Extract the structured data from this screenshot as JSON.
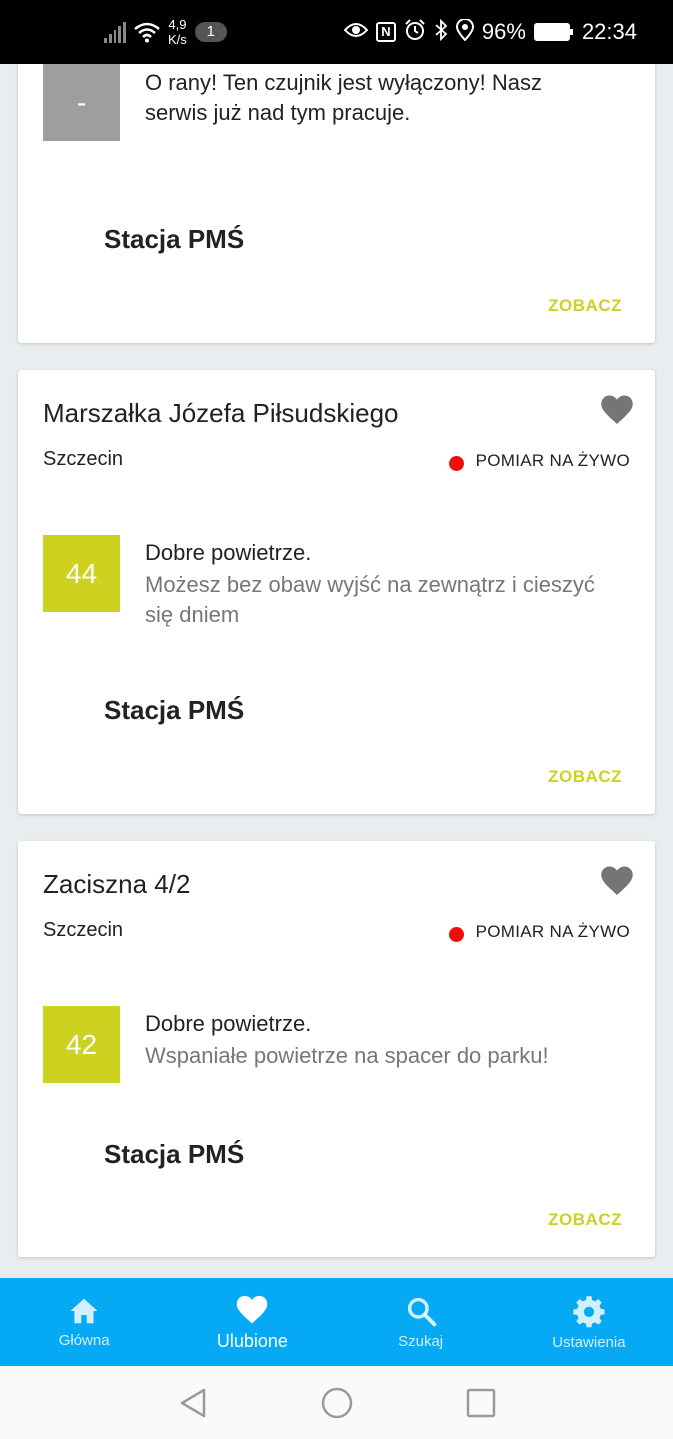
{
  "status_bar": {
    "net_speed_value": "4,9",
    "net_speed_unit": "K/s",
    "notification_count": "1",
    "nfc_label": "N",
    "battery_percent": "96%",
    "time": "22:34"
  },
  "cards": [
    {
      "aqi_value": "-",
      "status": "O rany! Ten czujnik jest wyłączony! Nasz",
      "status_line2": "serwis już nad tym pracuje.",
      "station": "Stacja PMŚ",
      "see_label": "ZOBACZ"
    },
    {
      "title": "Marszałka Józefa Piłsudskiego",
      "city": "Szczecin",
      "live_label": "POMIAR NA ŻYWO",
      "aqi_value": "44",
      "status": "Dobre powietrze.",
      "description": "Możesz bez obaw wyjść na zewnątrz i cieszyć się dniem",
      "station": "Stacja PMŚ",
      "see_label": "ZOBACZ"
    },
    {
      "title": "Zaciszna 4/2",
      "city": "Szczecin",
      "live_label": "POMIAR NA ŻYWO",
      "aqi_value": "42",
      "status": "Dobre powietrze.",
      "description": "Wspaniałe powietrze na spacer do parku!",
      "station": "Stacja PMŚ",
      "see_label": "ZOBACZ"
    }
  ],
  "bottom_nav": {
    "items": [
      {
        "label": "Główna",
        "icon": "home-icon"
      },
      {
        "label": "Ulubione",
        "icon": "heart-icon"
      },
      {
        "label": "Szukaj",
        "icon": "search-icon"
      },
      {
        "label": "Ustawienia",
        "icon": "gear-icon"
      }
    ],
    "active_index": 1
  },
  "colors": {
    "accent": "#cdd11f",
    "nav_background": "#05a9f4",
    "live_dot": "#f20d0d",
    "sensor_off": "#9e9e9e"
  }
}
